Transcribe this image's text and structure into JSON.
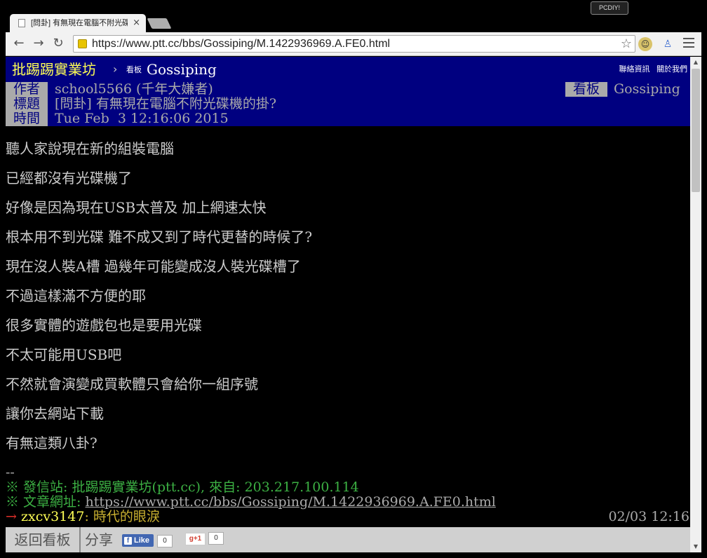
{
  "window": {
    "badge": "PCDIY!",
    "tab_title": "[問卦] 有無現在電腦不附光碟機的掛?",
    "tab_close": "×"
  },
  "toolbar": {
    "back": "←",
    "forward": "→",
    "reload": "↻",
    "url": "https://www.ptt.cc/bbs/Gossiping/M.1422936969.A.FE0.html",
    "star": "☆"
  },
  "ptt": {
    "brand": "批踢踢實業坊",
    "sep": "›",
    "board_label": "看板",
    "board": "Gossiping",
    "links": [
      "聯絡資訊",
      "關於我們"
    ]
  },
  "meta": {
    "author_tag": "作者",
    "author": "school5566 (千年大嫌者)",
    "board_tag": "看板",
    "board": "Gossiping",
    "title_tag": "標題",
    "title": "[問卦] 有無現在電腦不附光碟機的掛?",
    "time_tag": "時間",
    "time": "Tue Feb  3 12:16:06 2015"
  },
  "body": [
    "聽人家說現在新的組裝電腦",
    "已經都沒有光碟機了",
    "好像是因為現在USB太普及 加上網速太快",
    "根本用不到光碟 難不成又到了時代更替的時候了?",
    "現在沒人裝A槽 過幾年可能變成沒人裝光碟槽了",
    "不過這樣滿不方便的耶",
    "很多實體的遊戲包也是要用光碟",
    "不太可能用USB吧",
    "不然就會演變成買軟體只會給你一組序號",
    "讓你去網站下載",
    "有無這類八卦?"
  ],
  "signature": {
    "dashes": "--",
    "origin": "※ 發信站: 批踢踢實業坊(ptt.cc), 來自: 203.217.100.114",
    "url_label": "※ 文章網址: ",
    "url": "https://www.ptt.cc/bbs/Gossiping/M.1422936969.A.FE0.html"
  },
  "push": {
    "arrow": "→",
    "user": "zxcv3147",
    "content": ": 時代的眼淚",
    "time": "02/03 12:16"
  },
  "bottom": {
    "back": "返回看板",
    "share": "分享",
    "fb_like": "Like",
    "fb_count": "0",
    "gplus": "g+1",
    "gplus_count": "0"
  }
}
